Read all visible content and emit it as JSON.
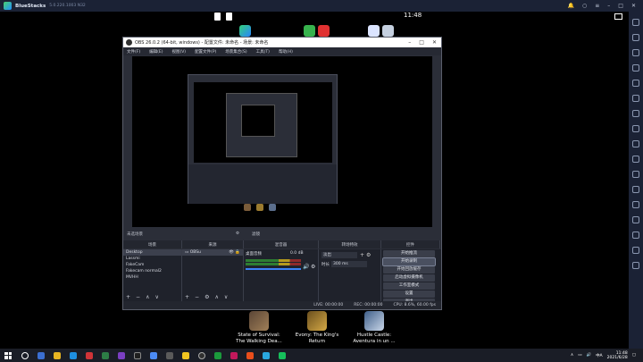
{
  "bluestacks": {
    "title": "BlueStacks",
    "version": "5.0.220.1003  N32",
    "android_clock": "11:48"
  },
  "obs": {
    "window_title": "OBS 26.0.2 (64-bit, windows) - 配置文件: 未命名 - 场景: 未命名",
    "menu": [
      "文件(F)",
      "编辑(E)",
      "视图(V)",
      "配置文件(P)",
      "场景集合(S)",
      "工具(T)",
      "帮助(H)"
    ],
    "scene_status": "未选场景",
    "scene_status_right": "滤镜",
    "dock_headers": [
      "场景",
      "来源",
      "混音器",
      "转场特效",
      "控件"
    ],
    "scenes": [
      "Desktop",
      "Lassmi",
      "FakeCam",
      "Fakecam normal2",
      "MVHH"
    ],
    "sources": [
      "OBSu"
    ],
    "mixer": {
      "label": "桌面音频",
      "level": "0.0 dB"
    },
    "transition": {
      "type": "淡出",
      "duration_label": "时长",
      "duration_value": "300 ms"
    },
    "controls": [
      "开始推流",
      "开始录制",
      "开始回放缓存",
      "启动虚拟摄像机",
      "工作室模式",
      "设置",
      "退出"
    ],
    "status": {
      "live": "LIVE: 00:00:00",
      "rec": "REC: 00:00:00",
      "cpu": "CPU: 8.6%, 60.00 fps"
    }
  },
  "tiles": [
    {
      "label_1": "State of Survival:",
      "label_2": "The Walking Dea..."
    },
    {
      "label_1": "Evony: The King's",
      "label_2": "Return"
    },
    {
      "label_1": "Hustle Castle:",
      "label_2": "Aventura in un ..."
    }
  ],
  "taskbar": {
    "lang": "中A",
    "time": "11:48",
    "date": "2021/6/28"
  }
}
